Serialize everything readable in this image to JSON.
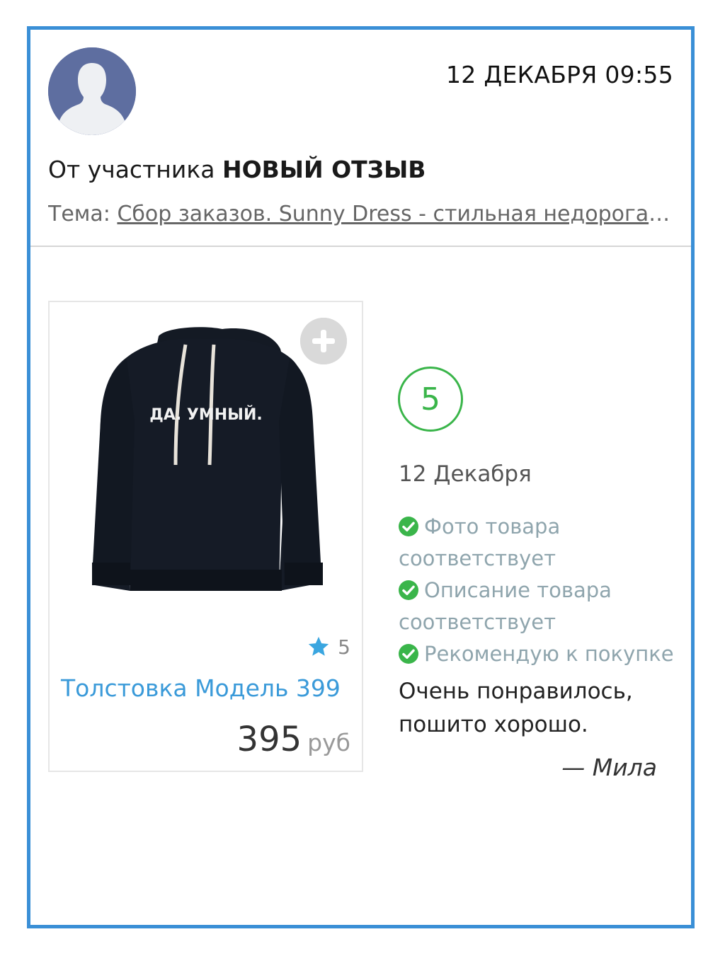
{
  "post": {
    "datetime": "12 ДЕКАБРЯ 09:55",
    "from_prefix": "От участника",
    "from_name": "НОВЫЙ ОТЗЫВ",
    "topic_label": "Тема:",
    "topic_link": "Сбор заказов. Sunny Dress - стильная недорогая одежда"
  },
  "product": {
    "image_text": "ДА. УМНЫЙ.",
    "rating": "5",
    "name": "Толстовка Модель 399",
    "price": "395",
    "currency": "руб"
  },
  "review": {
    "score": "5",
    "date": "12 Декабря",
    "checks": [
      "Фото товара соответствует",
      "Описание товара соответствует",
      "Рекомендую к покупке"
    ],
    "text": "Очень понравилось, пошито хорошо.",
    "author": "— Мила"
  },
  "colors": {
    "border": "#3a8fd6",
    "link": "#3a9ad9",
    "success": "#3ab54a",
    "star": "#3aa6e0",
    "avatar_bg": "#5e6ea0"
  },
  "icons": {
    "avatar": "user-silhouette-icon",
    "add": "plus-icon",
    "star": "star-icon",
    "check": "check-circle-icon"
  }
}
